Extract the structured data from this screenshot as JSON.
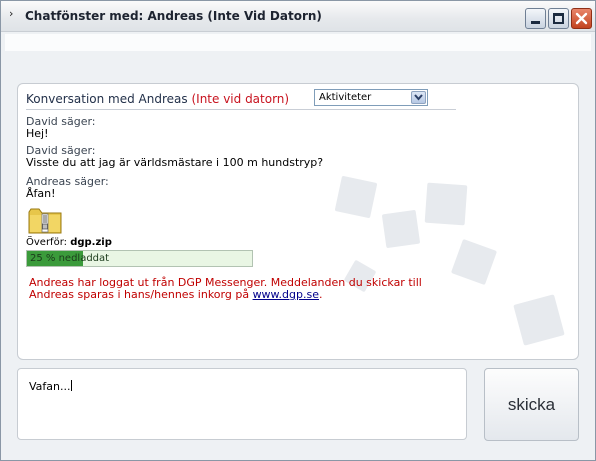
{
  "window": {
    "title_glyph": "›",
    "title": "Chatfönster med: Andreas (Inte Vid Datorn)"
  },
  "conversation": {
    "header_prefix": "Konversation med Andreas",
    "header_status": "(Inte vid datorn)",
    "activity_select_value": "Aktiviteter",
    "messages": [
      {
        "sender": "David säger:",
        "text": "Hej!"
      },
      {
        "sender": "David säger:",
        "text": "Visste du att jag är världsmästare i 100 m hundstryp?"
      },
      {
        "sender": "Andreas säger:",
        "text": "Åfan!"
      }
    ],
    "transfer": {
      "label": "Överför:",
      "filename": "dgp.zip",
      "progress_text": "25 % nedladdat",
      "progress_fraction": 0.25
    },
    "logout_notice": "Andreas har loggat ut från DGP Messenger. Meddelanden du skickar till Andreas sparas i hans/hennes inkorg på",
    "logout_link": "www.dgp.se",
    "logout_end": "."
  },
  "composer": {
    "value": "Vafan..."
  },
  "send_button": {
    "label": "skicka"
  },
  "colors": {
    "status_red": "#c8131f",
    "notice_red": "#c00000",
    "progress_green": "#3b9b3b",
    "link_blue": "#00008b"
  },
  "icons": [
    "minimize-icon",
    "maximize-icon",
    "close-icon",
    "dropdown-arrow-icon",
    "zip-file-icon"
  ]
}
